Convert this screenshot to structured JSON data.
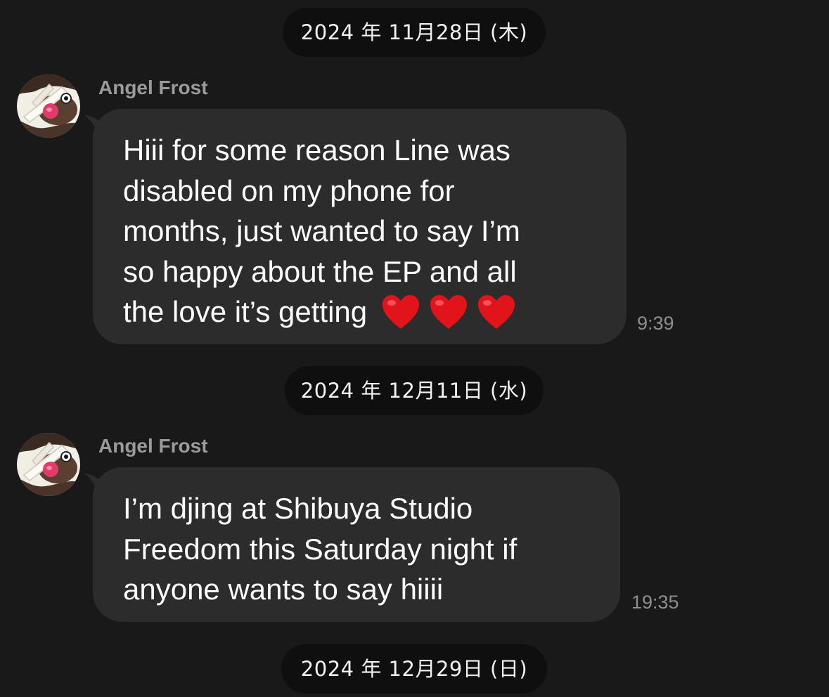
{
  "chat": {
    "days": [
      {
        "date_label": "2024 年 11月28日 (木)",
        "message": {
          "sender": "Angel Frost",
          "lines": [
            "Hiii for some reason Line was",
            "disabled on my phone for",
            "months, just wanted to say I’m",
            "so happy about the EP and all",
            "the love it’s getting"
          ],
          "emoji": [
            "red-heart",
            "red-heart",
            "red-heart"
          ],
          "time": "9:39"
        }
      },
      {
        "date_label": "2024 年 12月11日 (水)",
        "message": {
          "sender": "Angel Frost",
          "lines": [
            "I’m djing at Shibuya Studio",
            "Freedom this Saturday night if",
            "anyone wants to say hiiii"
          ],
          "time": "19:35"
        }
      },
      {
        "date_label": "2024 年 12月29日 (日)"
      }
    ]
  },
  "colors": {
    "background": "#191919",
    "bubble": "#2c2c2c",
    "date_pill": "#0f0f0f",
    "sender_name": "#9b9b9b",
    "timestamp": "#8e8e8e",
    "heart": "#e1141c"
  },
  "icons": {
    "avatar": "avatar-photo",
    "heart": "red-heart-emoji"
  }
}
